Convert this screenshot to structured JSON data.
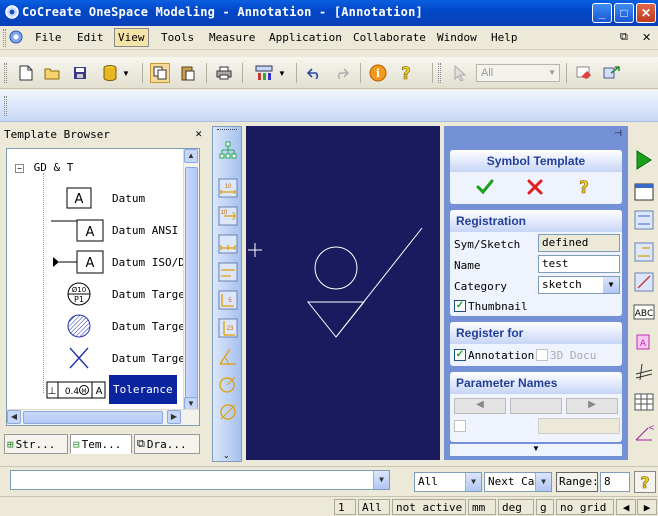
{
  "window": {
    "title": "CoCreate OneSpace Modeling - Annotation - [Annotation]",
    "minimize": "_",
    "maximize": "□",
    "close": "✕"
  },
  "menu": {
    "items": [
      "File",
      "Edit",
      "View",
      "Tools",
      "Measure",
      "Application",
      "Collaborate",
      "Window",
      "Help"
    ],
    "active": "View"
  },
  "toolbar": {
    "layer_select": "All"
  },
  "template_browser": {
    "title": "Template Browser",
    "root": "GD & T",
    "items": [
      {
        "label": "Datum",
        "symbol": "A"
      },
      {
        "label": "Datum ANSI",
        "symbol": "A"
      },
      {
        "label": "Datum ISO/DI",
        "symbol": "A"
      },
      {
        "label": "Datum Target",
        "symbol": "Ø10 P1"
      },
      {
        "label": "Datum Target",
        "symbol": ""
      },
      {
        "label": "Datum Target",
        "symbol": ""
      },
      {
        "label": "Tolerance",
        "symbol": "⊥ 0.4 M A"
      }
    ],
    "tabs": [
      "Str...",
      "Tem...",
      "Dra..."
    ]
  },
  "symbol_template": {
    "title": "Symbol Template",
    "registration": {
      "title": "Registration",
      "fields": [
        {
          "label": "Sym/Sketch",
          "value": "defined"
        },
        {
          "label": "Name",
          "value": "test"
        },
        {
          "label": "Category",
          "value": "sketch"
        }
      ],
      "thumbnail_label": "Thumbnail",
      "thumbnail_checked": true
    },
    "register_for": {
      "title": "Register for",
      "annotation_label": "Annotation",
      "annotation_checked": true,
      "docu_label": "3D Docu",
      "docu_checked": false
    },
    "parameter_names": {
      "title": "Parameter Names"
    }
  },
  "command_line": {
    "input": "",
    "scope": "All",
    "catch": "Next Cat",
    "range_label": "Range:",
    "range_value": "8"
  },
  "status": {
    "count": "1",
    "scope": "All",
    "state": "not active",
    "units_length": "mm",
    "units_angle": "deg",
    "units_mass": "g",
    "grid": "no grid"
  },
  "colors": {
    "canvas_bg": "#1a1a5e",
    "panel_bg": "#7490d6",
    "title_blue": "#0248c9"
  }
}
